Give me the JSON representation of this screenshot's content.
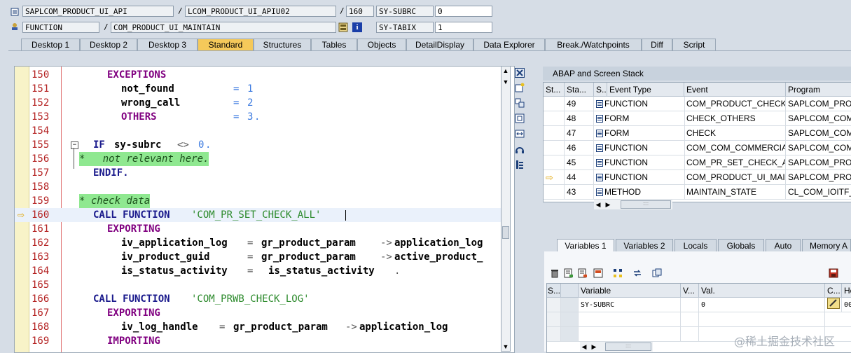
{
  "header": {
    "row1": {
      "program": "SAPLCOM_PRODUCT_UI_API",
      "include": "LCOM_PRODUCT_UI_APIU02",
      "line": "160",
      "sysvar_name": "SY-SUBRC",
      "sysvar_value": "0"
    },
    "row2": {
      "type": "FUNCTION",
      "name": "COM_PRODUCT_UI_MAINTAIN",
      "sysvar_name": "SY-TABIX",
      "sysvar_value": "1"
    },
    "separator": "/"
  },
  "tabs": [
    {
      "label": "Desktop 1"
    },
    {
      "label": "Desktop 2"
    },
    {
      "label": "Desktop 3"
    },
    {
      "label": "Standard",
      "active": true
    },
    {
      "label": "Structures"
    },
    {
      "label": "Tables"
    },
    {
      "label": "Objects"
    },
    {
      "label": "DetailDisplay"
    },
    {
      "label": "Data Explorer"
    },
    {
      "label": "Break./Watchpoints"
    },
    {
      "label": "Diff"
    },
    {
      "label": "Script"
    }
  ],
  "editor": {
    "current_line": "160",
    "lines": [
      {
        "num": "150"
      },
      {
        "num": "151"
      },
      {
        "num": "152"
      },
      {
        "num": "153"
      },
      {
        "num": "154"
      },
      {
        "num": "155"
      },
      {
        "num": "156"
      },
      {
        "num": "157"
      },
      {
        "num": "158"
      },
      {
        "num": "159"
      },
      {
        "num": "160"
      },
      {
        "num": "161"
      },
      {
        "num": "162"
      },
      {
        "num": "163"
      },
      {
        "num": "164"
      },
      {
        "num": "165"
      },
      {
        "num": "166"
      },
      {
        "num": "167"
      },
      {
        "num": "168"
      },
      {
        "num": "169"
      }
    ],
    "code": {
      "l150": "EXCEPTIONS",
      "l151_a": "not_found",
      "l151_b": "=",
      "l151_c": "1",
      "l152_a": "wrong_call",
      "l152_b": "=",
      "l152_c": "2",
      "l153_a": "OTHERS",
      "l153_b": "=",
      "l153_c": "3",
      "l153_d": ".",
      "l155_a": "IF",
      "l155_b": "sy-subrc",
      "l155_c": "<>",
      "l155_d": "0",
      "l155_e": ".",
      "l156": "*   not relevant here.",
      "l157": "ENDIF.",
      "l159": "* check data",
      "l160_a": "CALL FUNCTION",
      "l160_b": "'COM_PR_SET_CHECK_ALL'",
      "l161": "EXPORTING",
      "l162_a": "iv_application_log",
      "l162_b": "=",
      "l162_c": "gr_product_param",
      "l162_d": "->",
      "l162_e": "application_log",
      "l163_a": "iv_product_guid",
      "l163_b": "=",
      "l163_c": "gr_product_param",
      "l163_d": "->",
      "l163_e": "active_product_",
      "l164_a": "is_status_activity",
      "l164_b": "=",
      "l164_c": "is_status_activity",
      "l164_d": ".",
      "l166_a": "CALL FUNCTION",
      "l166_b": "'COM_PRWB_CHECK_LOG'",
      "l167": "EXPORTING",
      "l168_a": "iv_log_handle",
      "l168_b": "=",
      "l168_c": "gr_product_param",
      "l168_d": "->",
      "l168_e": "application_log",
      "l169": "IMPORTING"
    }
  },
  "stack_panel": {
    "title": "ABAP and Screen Stack",
    "columns": [
      "St...",
      "Sta...",
      "S...",
      "Event Type",
      "Event",
      "Program"
    ],
    "rows": [
      {
        "stack": "49",
        "event_type": "FUNCTION",
        "event": "COM_PRODUCT_CHECK_...",
        "program": "SAPLCOM_PRODU"
      },
      {
        "stack": "48",
        "event_type": "FORM",
        "event": "CHECK_OTHERS",
        "program": "SAPLCOM_COM_C"
      },
      {
        "stack": "47",
        "event_type": "FORM",
        "event": "CHECK",
        "program": "SAPLCOM_COM_C"
      },
      {
        "stack": "46",
        "event_type": "FUNCTION",
        "event": "COM_COM_COMMERCIAL...",
        "program": "SAPLCOM_COM_C"
      },
      {
        "stack": "45",
        "event_type": "FUNCTION",
        "event": "COM_PR_SET_CHECK_A...",
        "program": "SAPLCOM_PRODU"
      },
      {
        "stack": "44",
        "event_type": "FUNCTION",
        "event": "COM_PRODUCT_UI_MAI...",
        "program": "SAPLCOM_PRODU",
        "current": true
      },
      {
        "stack": "43",
        "event_type": "METHOD",
        "event": "MAINTAIN_STATE",
        "program": "CL_COM_IOITF_S"
      }
    ]
  },
  "variable_tabs": [
    {
      "label": "Variables 1",
      "active": true
    },
    {
      "label": "Variables 2"
    },
    {
      "label": "Locals"
    },
    {
      "label": "Globals"
    },
    {
      "label": "Auto"
    },
    {
      "label": "Memory A"
    }
  ],
  "variables_grid": {
    "columns": [
      "S...",
      "Variable",
      "V...",
      "Val.",
      "C...",
      "He"
    ],
    "rows": [
      {
        "variable": "SY-SUBRC",
        "value": "0",
        "hex": "00"
      }
    ]
  },
  "icons": {
    "header_program": "program-icon",
    "header_function": "function-icon",
    "toolbar": [
      "close-icon",
      "new-tool-icon",
      "replace-tool-icon",
      "fullscreen-icon",
      "swap-icon",
      "services-icon",
      "tool-settings-icon"
    ],
    "var_toolbar": [
      "delete-icon",
      "import-icon",
      "export-icon",
      "save-icon",
      "tree-icon",
      "transfer-icon",
      "copy-icon",
      "disk-save-icon"
    ]
  },
  "watermark": "@稀土掘金技术社区"
}
